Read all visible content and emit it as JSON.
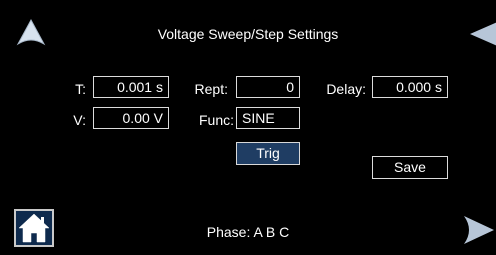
{
  "title": "Voltage Sweep/Step Settings",
  "fields": {
    "t_label": "T:",
    "t_value": "0.001 s",
    "v_label": "V:",
    "v_value": "0.00 V",
    "rept_label": "Rept:",
    "rept_value": "0",
    "func_label": "Func:",
    "func_value": "SINE",
    "delay_label": "Delay:",
    "delay_value": "0.000 s"
  },
  "buttons": {
    "trig_label": "Trig",
    "save_label": "Save"
  },
  "footer": {
    "phase_text": "Phase: A B C"
  },
  "icons": {
    "up": "arrow-up-icon",
    "prev": "arrow-left-icon",
    "next": "arrow-right-icon",
    "home": "home-icon"
  },
  "colors": {
    "background": "#000000",
    "button_fill": "#1f3d63",
    "arrow": "#d7e2ee"
  }
}
